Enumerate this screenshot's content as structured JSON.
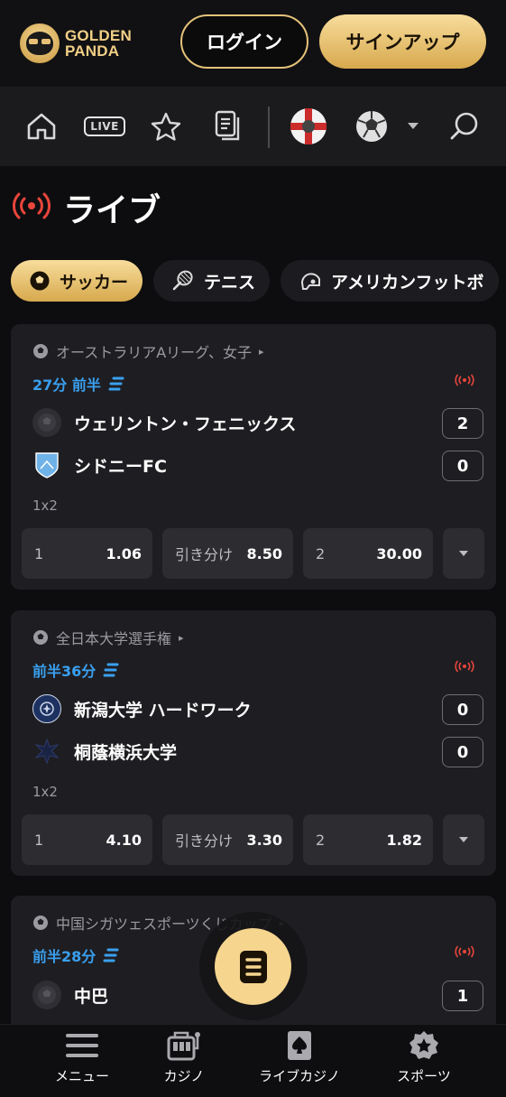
{
  "header": {
    "logo_line1": "GOLDEN",
    "logo_line2": "PANDA",
    "login_label": "ログイン",
    "signup_label": "サインアップ"
  },
  "nav": {
    "live_label": "LIVE",
    "icons": [
      "home-icon",
      "live-icon",
      "star-icon",
      "betslip-doc-icon",
      "flag-ball-icon",
      "soccer-ball-icon",
      "chevron-down-icon",
      "search-icon"
    ]
  },
  "page": {
    "title": "ライブ"
  },
  "chips": [
    {
      "label": "サッカー",
      "icon": "soccer-ball-icon",
      "active": true
    },
    {
      "label": "テニス",
      "icon": "tennis-racket-icon",
      "active": false
    },
    {
      "label": "アメリカンフットボ",
      "icon": "football-helmet-icon",
      "active": false
    }
  ],
  "matches": [
    {
      "league": "オーストラリアAリーグ、女子",
      "time": "27分 前半",
      "team1": {
        "name": "ウェリントン・フェニックス",
        "score": "2"
      },
      "team2": {
        "name": "シドニーFC",
        "score": "0"
      },
      "market": "1x2",
      "odds": [
        {
          "label": "1",
          "value": "1.06"
        },
        {
          "label": "引き分け",
          "value": "8.50"
        },
        {
          "label": "2",
          "value": "30.00"
        }
      ]
    },
    {
      "league": "全日本大学選手権",
      "time": "前半36分",
      "team1": {
        "name": "新潟大学 ハードワーク",
        "score": "0"
      },
      "team2": {
        "name": "桐蔭横浜大学",
        "score": "0"
      },
      "market": "1x2",
      "odds": [
        {
          "label": "1",
          "value": "4.10"
        },
        {
          "label": "引き分け",
          "value": "3.30"
        },
        {
          "label": "2",
          "value": "1.82"
        }
      ]
    },
    {
      "league": "中国シガツェスポーツくじカップ",
      "time": "前半28分",
      "team1": {
        "name": "中巴",
        "score": "1"
      }
    }
  ],
  "bottom_nav": [
    {
      "label": "メニュー",
      "icon": "hamburger-menu-icon"
    },
    {
      "label": "カジノ",
      "icon": "slot-machine-icon"
    },
    {
      "label": "ライブカジノ",
      "icon": "spade-card-icon"
    },
    {
      "label": "スポーツ",
      "icon": "sports-badge-icon"
    }
  ],
  "colors": {
    "gold": "#f6d58f",
    "live_red": "#e8453c",
    "time_blue": "#3aa0f0",
    "card_bg": "#1e1e22"
  }
}
